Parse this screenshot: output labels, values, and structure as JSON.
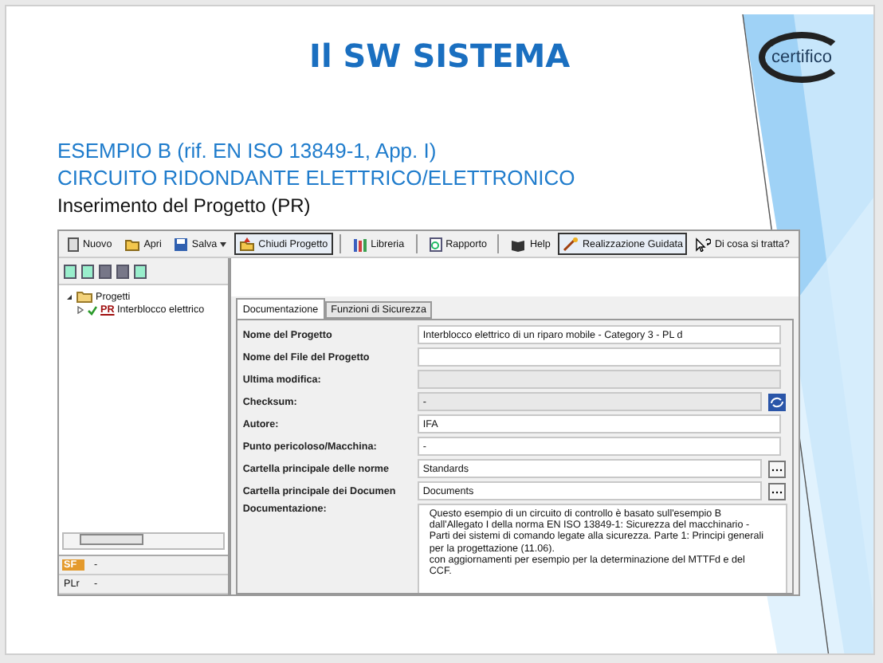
{
  "slide": {
    "title": "Il SW SISTEMA",
    "logo": "certifico",
    "heading_lines": [
      "ESEMPIO B (rif. EN ISO 13849-1, App. I)",
      "CIRCUITO RIDONDANTE ELETTRICO/ELETTRONICO"
    ],
    "caption": "Inserimento del Progetto (PR)"
  },
  "toolbar": [
    {
      "kind": "button",
      "label": "Nuovo",
      "highlighted": false
    },
    {
      "kind": "button",
      "label": "Apri",
      "highlighted": false
    },
    {
      "kind": "dropdown",
      "label": "Salva",
      "highlighted": false
    },
    {
      "kind": "button",
      "label": "Chiudi Progetto",
      "highlighted": true
    },
    {
      "kind": "separator"
    },
    {
      "kind": "button",
      "label": "Libreria",
      "highlighted": false
    },
    {
      "kind": "separator"
    },
    {
      "kind": "button",
      "label": "Rapporto",
      "highlighted": false
    },
    {
      "kind": "separator"
    },
    {
      "kind": "button",
      "label": "Help",
      "highlighted": false
    },
    {
      "kind": "button",
      "label": "Realizzazione Guidata",
      "highlighted": true
    },
    {
      "kind": "button",
      "label": "Di cosa si tratta?",
      "highlighted": false
    }
  ],
  "tree": {
    "label": "Progetti",
    "expanded": true,
    "children": [
      {
        "badge": "PR",
        "label": "Interblocco elettrico",
        "checked": true,
        "expanded": false
      }
    ]
  },
  "tabs": [
    {
      "label": "Documentazione",
      "selected": true
    },
    {
      "label": "Funzioni di Sicurezza",
      "selected": false
    }
  ],
  "fields": [
    {
      "kind": "text",
      "label": "Nome del Progetto",
      "value": "Interblocco elettrico di un riparo mobile - Category 3 - PL d"
    },
    {
      "kind": "text",
      "label": "Nome del File del Progetto"
    },
    {
      "kind": "readonly",
      "label": "Ultima modifica:"
    },
    {
      "kind": "checksum",
      "label": "Checksum:",
      "value": "-"
    },
    {
      "kind": "text",
      "label": "Autore:",
      "value": "IFA"
    },
    {
      "kind": "text",
      "label": "Punto pericoloso/Macchina:",
      "value": "-"
    },
    {
      "kind": "browse",
      "label": "Cartella principale delle norme",
      "value": "Standards"
    },
    {
      "kind": "browse",
      "label": "Cartella principale dei Documen",
      "value": "Documents"
    }
  ],
  "documentation": {
    "label": "Documentazione:",
    "lines": [
      "Questo esempio di un circuito di controllo  è basato sull'esempio  B",
      "dall'Allegato I della norma EN ISO 13849-1: Sicurezza del macchinario -",
      "Parti dei sistemi di comando legate alla sicurezza. Parte 1: Principi generali",
      "per la progettazione (11.06).",
      "con aggiornamenti per esempio per la determinazione del MTTFd e del",
      "CCF."
    ]
  },
  "status": [
    {
      "kind": "badge",
      "label": "SF",
      "value": "-"
    },
    {
      "kind": "plain",
      "label": "PLr",
      "value": "-"
    }
  ]
}
